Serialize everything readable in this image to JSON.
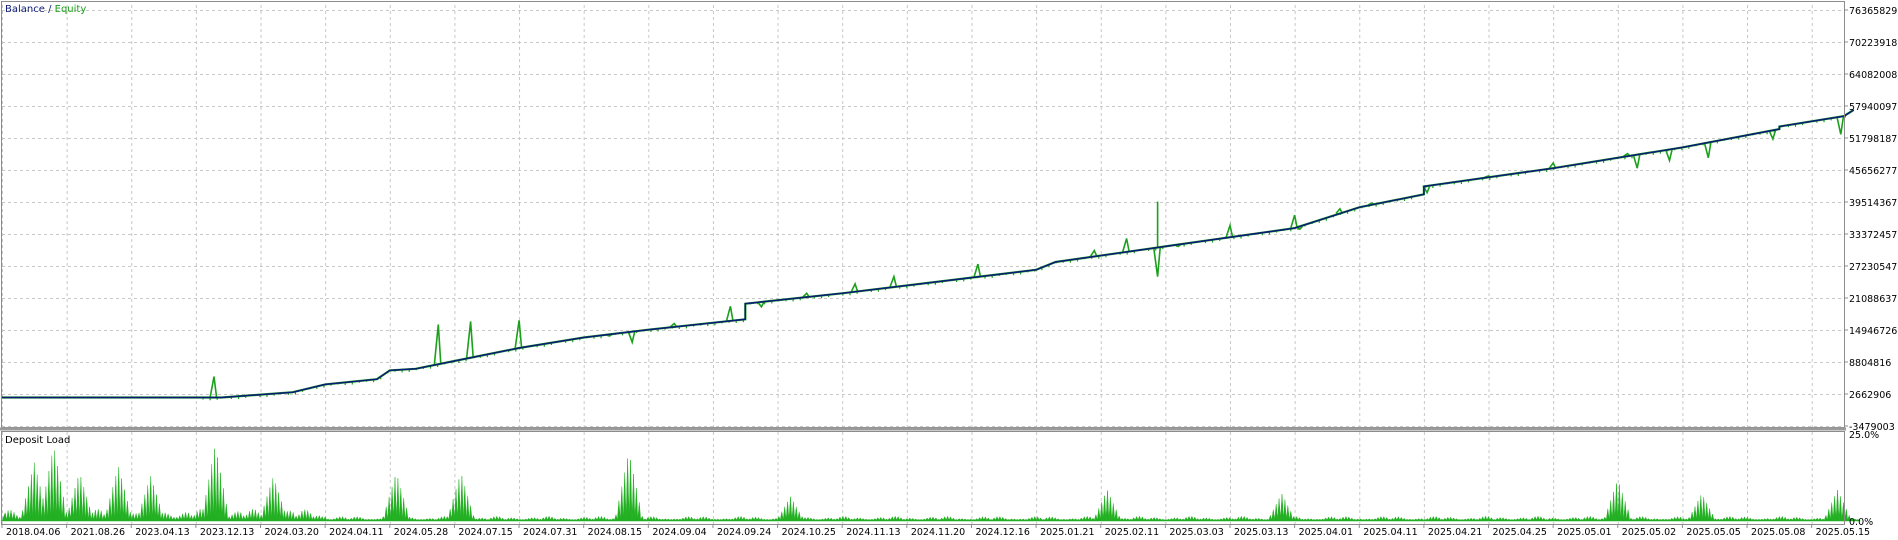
{
  "legend": {
    "balance_label": "Balance",
    "separator": " / ",
    "equity_label": "Equity",
    "balance_color": "#0b1a78",
    "equity_color": "#1aa01a"
  },
  "colors": {
    "background": "#ffffff",
    "grid": "#c8c8c8",
    "frame": "#8c8c8c",
    "pane_separator": "#9a9a9a",
    "deposit_load": "#22b022",
    "text": "#000000"
  },
  "chart_data": [
    {
      "type": "line",
      "title": "",
      "xlabel": "",
      "ylabel": "",
      "grid": true,
      "legend_position": "top-left",
      "y_tick_labels": [
        "76365829",
        "70223918",
        "64082008",
        "57940097",
        "51798187",
        "45656277",
        "39514367",
        "33372457",
        "27230547",
        "21088637",
        "14946726",
        "8804816",
        "2662906",
        "-3479003"
      ],
      "ylim": [
        -3479003,
        76365829
      ],
      "x_tick_labels": [
        "2018.04.06",
        "2021.08.26",
        "2023.04.13",
        "2023.12.13",
        "2024.03.20",
        "2024.04.11",
        "2024.05.28",
        "2024.07.15",
        "2024.07.31",
        "2024.08.15",
        "2024.09.04",
        "2024.09.24",
        "2024.10.25",
        "2024.11.13",
        "2024.11.20",
        "2024.12.16",
        "2025.01.21",
        "2025.02.11",
        "2025.03.03",
        "2025.03.13",
        "2025.04.01",
        "2025.04.11",
        "2025.04.21",
        "2025.04.25",
        "2025.05.01",
        "2025.05.02",
        "2025.05.05",
        "2025.05.08",
        "2025.05.15"
      ],
      "series": [
        {
          "name": "Balance",
          "x": [
            0,
            3.4,
            4.5,
            5.0,
            5.8,
            6.0,
            6.4,
            7.0,
            8.0,
            9.0,
            10.0,
            11.5,
            11.5,
            13.0,
            15.0,
            16.0,
            16.3,
            18.0,
            20.0,
            21.0,
            22.0,
            22.0,
            24.0,
            26.0,
            27.5,
            27.5,
            28.5,
            28.65
          ],
          "values": [
            2000000,
            2000000,
            3000000,
            4500000,
            5500000,
            7200000,
            7500000,
            9000000,
            11500000,
            13500000,
            15000000,
            17000000,
            20000000,
            22000000,
            25000000,
            26500000,
            28000000,
            31000000,
            34500000,
            38500000,
            41000000,
            42500000,
            46000000,
            50000000,
            53500000,
            54000000,
            56000000,
            57200000
          ]
        },
        {
          "name": "Equity",
          "dips": [
            {
              "x": 3.28,
              "value": 6000000
            },
            {
              "x": 6.75,
              "value": 16000000
            },
            {
              "x": 7.25,
              "value": 16600000
            },
            {
              "x": 8.0,
              "value": 16800000
            },
            {
              "x": 9.4,
              "value": 13800000
            },
            {
              "x": 9.75,
              "value": 12600000
            },
            {
              "x": 10.4,
              "value": 16200000
            },
            {
              "x": 11.27,
              "value": 19500000
            },
            {
              "x": 11.75,
              "value": 19400000
            },
            {
              "x": 12.45,
              "value": 22000000
            },
            {
              "x": 13.2,
              "value": 23800000
            },
            {
              "x": 13.8,
              "value": 25200000
            },
            {
              "x": 15.1,
              "value": 27600000
            },
            {
              "x": 16.9,
              "value": 30200000
            },
            {
              "x": 17.4,
              "value": 32500000
            },
            {
              "x": 17.88,
              "value": 25200000
            },
            {
              "x": 18.2,
              "value": 31000000
            },
            {
              "x": 19.0,
              "value": 35000000
            },
            {
              "x": 20.0,
              "value": 37000000
            },
            {
              "x": 20.08,
              "value": 34300000
            },
            {
              "x": 20.7,
              "value": 38200000
            },
            {
              "x": 21.2,
              "value": 39300000
            },
            {
              "x": 22.05,
              "value": 41300000
            },
            {
              "x": 23.0,
              "value": 44500000
            },
            {
              "x": 24.0,
              "value": 47000000
            },
            {
              "x": 25.15,
              "value": 48800000
            },
            {
              "x": 25.3,
              "value": 46000000
            },
            {
              "x": 25.8,
              "value": 47500000
            },
            {
              "x": 26.4,
              "value": 48000000
            },
            {
              "x": 27.4,
              "value": 51600000
            },
            {
              "x": 28.45,
              "value": 52500000
            }
          ],
          "spikes": [
            {
              "x": 17.88,
              "value": 39600000
            }
          ]
        }
      ]
    },
    {
      "type": "area",
      "title": "Deposit Load",
      "ylim": [
        0,
        25
      ],
      "y_tick_labels": [
        "25.0%",
        "0.0%"
      ],
      "peaks": [
        {
          "x": 0.5,
          "value": 17
        },
        {
          "x": 0.8,
          "value": 22
        },
        {
          "x": 1.2,
          "value": 14
        },
        {
          "x": 1.8,
          "value": 16
        },
        {
          "x": 2.3,
          "value": 13
        },
        {
          "x": 3.3,
          "value": 22
        },
        {
          "x": 4.2,
          "value": 13
        },
        {
          "x": 6.1,
          "value": 14
        },
        {
          "x": 7.1,
          "value": 14
        },
        {
          "x": 9.7,
          "value": 20
        },
        {
          "x": 12.2,
          "value": 7
        },
        {
          "x": 17.1,
          "value": 9
        },
        {
          "x": 19.8,
          "value": 8
        },
        {
          "x": 25.0,
          "value": 12
        },
        {
          "x": 26.3,
          "value": 8
        },
        {
          "x": 28.4,
          "value": 9
        }
      ]
    }
  ]
}
